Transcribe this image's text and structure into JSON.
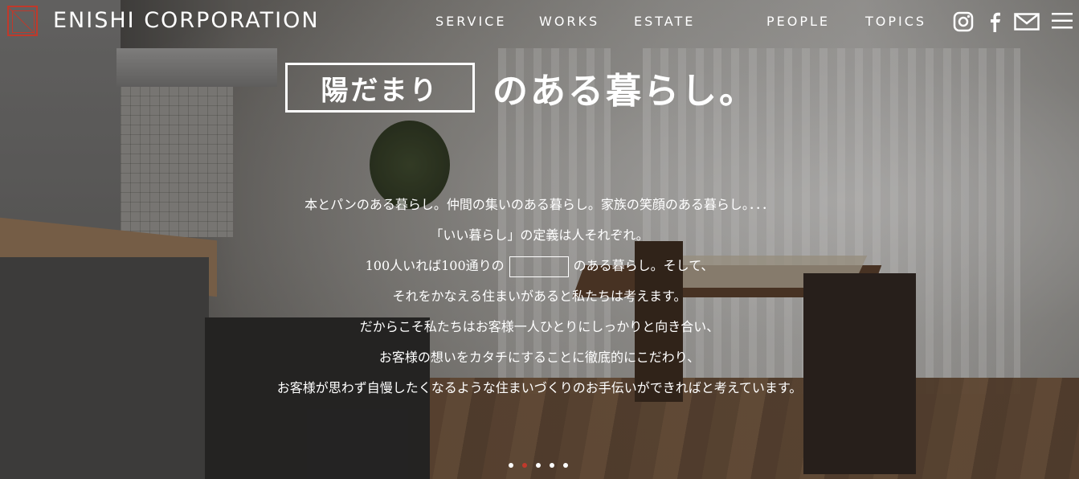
{
  "brand": {
    "name": "ENISHI CORPORATION",
    "logo_icon": "enishi-logo-mark",
    "accent_color": "#c0392b"
  },
  "nav": {
    "items": [
      "SERVICE",
      "WORKS",
      "ESTATE",
      "PEOPLE",
      "TOPICS"
    ]
  },
  "header_icons": [
    "instagram-icon",
    "facebook-icon",
    "mail-icon",
    "menu-icon"
  ],
  "hero": {
    "headline_box": "陽だまり",
    "headline_rest": "のある暮らし。",
    "lines": {
      "l1": "本とパンのある暮らし。仲間の集いのある暮らし。家族の笑顔のある暮らし。．．．",
      "l2": "「いい暮らし」の定義は人それぞれ。",
      "l3a": "100人いれば100通りの",
      "l3b": "のある暮らし。そして、",
      "l4": "それをかなえる住まいがあると私たちは考えます。",
      "l5": "だからこそ私たちはお客様一人ひとりにしっかりと向き合い、",
      "l6": "お客様の想いをカタチにすることに徹底的にこだわり、",
      "l7": "お客様が思わず自慢したくなるような住まいづくりのお手伝いができればと考えています。"
    }
  },
  "slider": {
    "count": 5,
    "active_index": 1
  }
}
